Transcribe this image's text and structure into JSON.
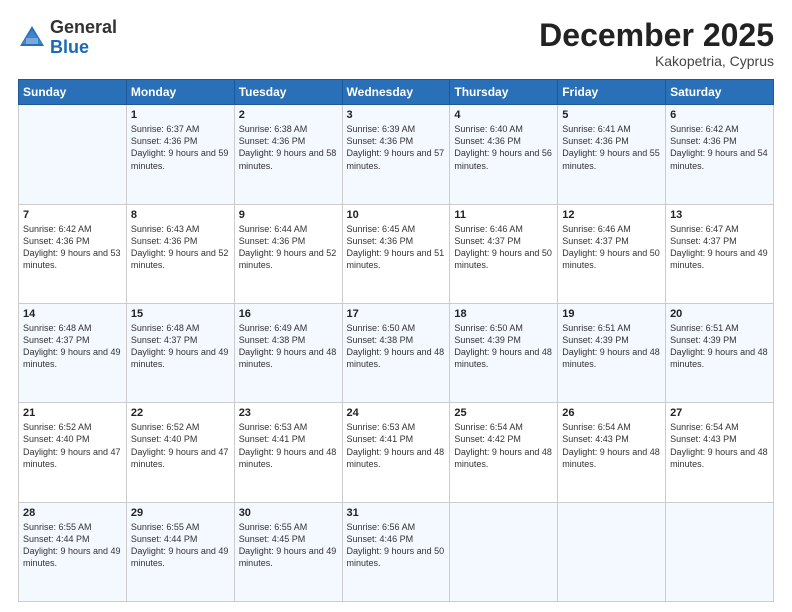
{
  "header": {
    "logo_general": "General",
    "logo_blue": "Blue",
    "month_title": "December 2025",
    "location": "Kakopetria, Cyprus"
  },
  "days_of_week": [
    "Sunday",
    "Monday",
    "Tuesday",
    "Wednesday",
    "Thursday",
    "Friday",
    "Saturday"
  ],
  "weeks": [
    [
      {
        "day": "",
        "sunrise": "",
        "sunset": "",
        "daylight": ""
      },
      {
        "day": "1",
        "sunrise": "Sunrise: 6:37 AM",
        "sunset": "Sunset: 4:36 PM",
        "daylight": "Daylight: 9 hours and 59 minutes."
      },
      {
        "day": "2",
        "sunrise": "Sunrise: 6:38 AM",
        "sunset": "Sunset: 4:36 PM",
        "daylight": "Daylight: 9 hours and 58 minutes."
      },
      {
        "day": "3",
        "sunrise": "Sunrise: 6:39 AM",
        "sunset": "Sunset: 4:36 PM",
        "daylight": "Daylight: 9 hours and 57 minutes."
      },
      {
        "day": "4",
        "sunrise": "Sunrise: 6:40 AM",
        "sunset": "Sunset: 4:36 PM",
        "daylight": "Daylight: 9 hours and 56 minutes."
      },
      {
        "day": "5",
        "sunrise": "Sunrise: 6:41 AM",
        "sunset": "Sunset: 4:36 PM",
        "daylight": "Daylight: 9 hours and 55 minutes."
      },
      {
        "day": "6",
        "sunrise": "Sunrise: 6:42 AM",
        "sunset": "Sunset: 4:36 PM",
        "daylight": "Daylight: 9 hours and 54 minutes."
      }
    ],
    [
      {
        "day": "7",
        "sunrise": "Sunrise: 6:42 AM",
        "sunset": "Sunset: 4:36 PM",
        "daylight": "Daylight: 9 hours and 53 minutes."
      },
      {
        "day": "8",
        "sunrise": "Sunrise: 6:43 AM",
        "sunset": "Sunset: 4:36 PM",
        "daylight": "Daylight: 9 hours and 52 minutes."
      },
      {
        "day": "9",
        "sunrise": "Sunrise: 6:44 AM",
        "sunset": "Sunset: 4:36 PM",
        "daylight": "Daylight: 9 hours and 52 minutes."
      },
      {
        "day": "10",
        "sunrise": "Sunrise: 6:45 AM",
        "sunset": "Sunset: 4:36 PM",
        "daylight": "Daylight: 9 hours and 51 minutes."
      },
      {
        "day": "11",
        "sunrise": "Sunrise: 6:46 AM",
        "sunset": "Sunset: 4:37 PM",
        "daylight": "Daylight: 9 hours and 50 minutes."
      },
      {
        "day": "12",
        "sunrise": "Sunrise: 6:46 AM",
        "sunset": "Sunset: 4:37 PM",
        "daylight": "Daylight: 9 hours and 50 minutes."
      },
      {
        "day": "13",
        "sunrise": "Sunrise: 6:47 AM",
        "sunset": "Sunset: 4:37 PM",
        "daylight": "Daylight: 9 hours and 49 minutes."
      }
    ],
    [
      {
        "day": "14",
        "sunrise": "Sunrise: 6:48 AM",
        "sunset": "Sunset: 4:37 PM",
        "daylight": "Daylight: 9 hours and 49 minutes."
      },
      {
        "day": "15",
        "sunrise": "Sunrise: 6:48 AM",
        "sunset": "Sunset: 4:37 PM",
        "daylight": "Daylight: 9 hours and 49 minutes."
      },
      {
        "day": "16",
        "sunrise": "Sunrise: 6:49 AM",
        "sunset": "Sunset: 4:38 PM",
        "daylight": "Daylight: 9 hours and 48 minutes."
      },
      {
        "day": "17",
        "sunrise": "Sunrise: 6:50 AM",
        "sunset": "Sunset: 4:38 PM",
        "daylight": "Daylight: 9 hours and 48 minutes."
      },
      {
        "day": "18",
        "sunrise": "Sunrise: 6:50 AM",
        "sunset": "Sunset: 4:39 PM",
        "daylight": "Daylight: 9 hours and 48 minutes."
      },
      {
        "day": "19",
        "sunrise": "Sunrise: 6:51 AM",
        "sunset": "Sunset: 4:39 PM",
        "daylight": "Daylight: 9 hours and 48 minutes."
      },
      {
        "day": "20",
        "sunrise": "Sunrise: 6:51 AM",
        "sunset": "Sunset: 4:39 PM",
        "daylight": "Daylight: 9 hours and 48 minutes."
      }
    ],
    [
      {
        "day": "21",
        "sunrise": "Sunrise: 6:52 AM",
        "sunset": "Sunset: 4:40 PM",
        "daylight": "Daylight: 9 hours and 47 minutes."
      },
      {
        "day": "22",
        "sunrise": "Sunrise: 6:52 AM",
        "sunset": "Sunset: 4:40 PM",
        "daylight": "Daylight: 9 hours and 47 minutes."
      },
      {
        "day": "23",
        "sunrise": "Sunrise: 6:53 AM",
        "sunset": "Sunset: 4:41 PM",
        "daylight": "Daylight: 9 hours and 48 minutes."
      },
      {
        "day": "24",
        "sunrise": "Sunrise: 6:53 AM",
        "sunset": "Sunset: 4:41 PM",
        "daylight": "Daylight: 9 hours and 48 minutes."
      },
      {
        "day": "25",
        "sunrise": "Sunrise: 6:54 AM",
        "sunset": "Sunset: 4:42 PM",
        "daylight": "Daylight: 9 hours and 48 minutes."
      },
      {
        "day": "26",
        "sunrise": "Sunrise: 6:54 AM",
        "sunset": "Sunset: 4:43 PM",
        "daylight": "Daylight: 9 hours and 48 minutes."
      },
      {
        "day": "27",
        "sunrise": "Sunrise: 6:54 AM",
        "sunset": "Sunset: 4:43 PM",
        "daylight": "Daylight: 9 hours and 48 minutes."
      }
    ],
    [
      {
        "day": "28",
        "sunrise": "Sunrise: 6:55 AM",
        "sunset": "Sunset: 4:44 PM",
        "daylight": "Daylight: 9 hours and 49 minutes."
      },
      {
        "day": "29",
        "sunrise": "Sunrise: 6:55 AM",
        "sunset": "Sunset: 4:44 PM",
        "daylight": "Daylight: 9 hours and 49 minutes."
      },
      {
        "day": "30",
        "sunrise": "Sunrise: 6:55 AM",
        "sunset": "Sunset: 4:45 PM",
        "daylight": "Daylight: 9 hours and 49 minutes."
      },
      {
        "day": "31",
        "sunrise": "Sunrise: 6:56 AM",
        "sunset": "Sunset: 4:46 PM",
        "daylight": "Daylight: 9 hours and 50 minutes."
      },
      {
        "day": "",
        "sunrise": "",
        "sunset": "",
        "daylight": ""
      },
      {
        "day": "",
        "sunrise": "",
        "sunset": "",
        "daylight": ""
      },
      {
        "day": "",
        "sunrise": "",
        "sunset": "",
        "daylight": ""
      }
    ]
  ]
}
